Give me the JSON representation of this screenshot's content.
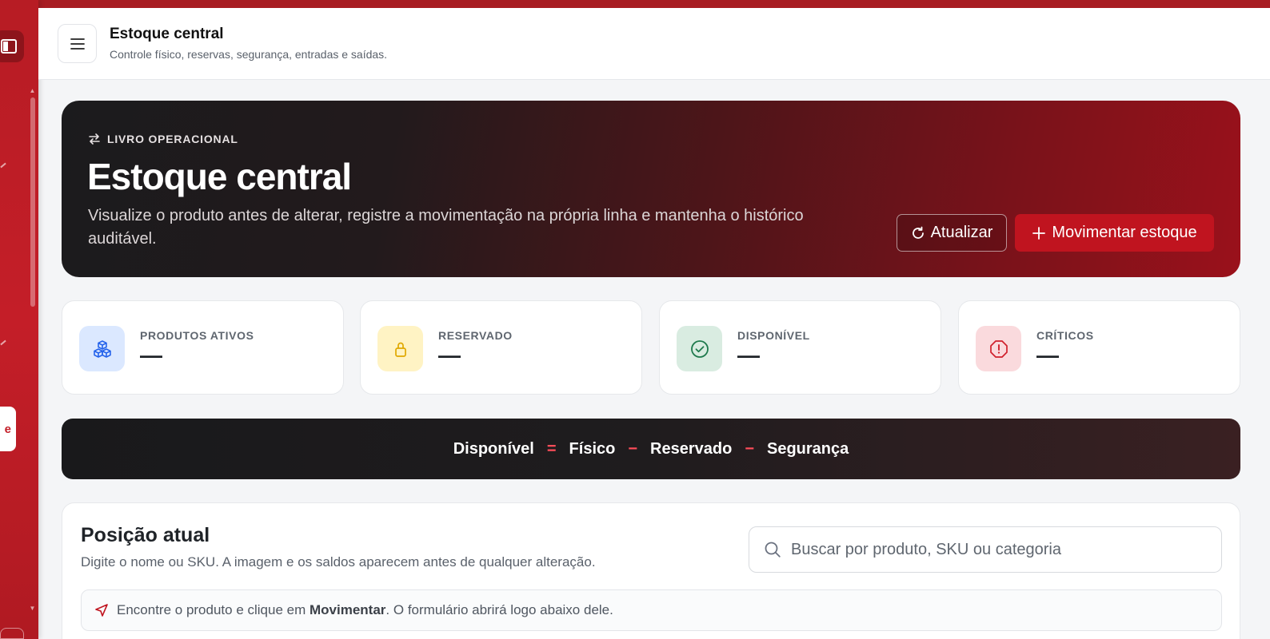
{
  "header": {
    "title": "Estoque central",
    "subtitle": "Controle físico, reservas, segurança, entradas e saídas."
  },
  "sidebar": {
    "card_letter": "e"
  },
  "hero": {
    "eyebrow": "LIVRO OPERACIONAL",
    "title": "Estoque central",
    "description": "Visualize o produto antes de alterar, registre a movimentação na própria linha e mantenha o histórico auditável.",
    "refresh_label": "Atualizar",
    "move_label": "Movimentar estoque"
  },
  "stats": [
    {
      "label": "PRODUTOS ATIVOS",
      "value": "—",
      "icon": "cubes-icon",
      "color": "#2563eb",
      "bg": "#dbe8ff"
    },
    {
      "label": "RESERVADO",
      "value": "—",
      "icon": "lock-icon",
      "color": "#e0a800",
      "bg": "#fff3c4"
    },
    {
      "label": "DISPONÍVEL",
      "value": "—",
      "icon": "check-circle-icon",
      "color": "#1f7a4d",
      "bg": "#d9ece1"
    },
    {
      "label": "CRÍTICOS",
      "value": "—",
      "icon": "alert-octagon-icon",
      "color": "#d0202c",
      "bg": "#fadadd"
    }
  ],
  "formula": {
    "terms": [
      "Disponível",
      "Físico",
      "Reservado",
      "Segurança"
    ],
    "ops": [
      "=",
      "−",
      "−"
    ]
  },
  "panel": {
    "title": "Posição atual",
    "subtitle": "Digite o nome ou SKU. A imagem e os saldos aparecem antes de qualquer alteração.",
    "search_placeholder": "Buscar por produto, SKU ou categoria",
    "hint_prefix": "Encontre o produto e clique em",
    "hint_bold": "Movimentar",
    "hint_suffix": ". O formulário abrirá logo abaixo dele."
  },
  "colors": {
    "brand": "#c0141f",
    "sidebar": "#c41e28"
  }
}
